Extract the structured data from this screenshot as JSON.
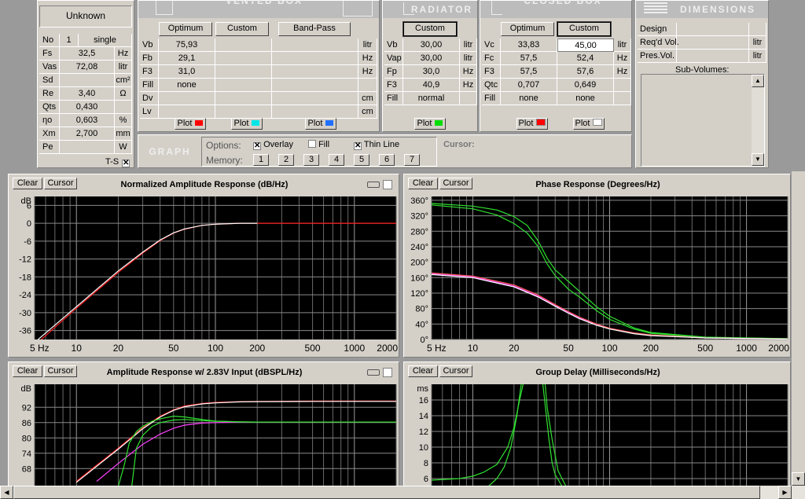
{
  "driver": {
    "name": "Unknown",
    "no_label": "No",
    "no_value": "1",
    "mode": "single",
    "params": [
      {
        "sym": "Fs",
        "val": "32,5",
        "unit": "Hz"
      },
      {
        "sym": "Vas",
        "val": "72,08",
        "unit": "litr"
      },
      {
        "sym": "Sd",
        "val": "",
        "unit": "cm²"
      },
      {
        "sym": "Re",
        "val": "3,40",
        "unit": "Ω"
      },
      {
        "sym": "Qts",
        "val": "0,430",
        "unit": ""
      },
      {
        "sym": "ηo",
        "val": "0,603",
        "unit": "%"
      },
      {
        "sym": "Xm",
        "val": "2,700",
        "unit": "mm"
      },
      {
        "sym": "Pe",
        "val": "",
        "unit": "W"
      }
    ],
    "ts_label": "T-S"
  },
  "vented": {
    "title": "VENTED BOX",
    "buttons": [
      "Optimum",
      "Custom",
      "Band-Pass"
    ],
    "rows": [
      {
        "sym": "Vb",
        "c1": "75,93",
        "c2": "",
        "c3": "",
        "unit": "litr"
      },
      {
        "sym": "Fb",
        "c1": "29,1",
        "c2": "",
        "c3": "",
        "unit": "Hz"
      },
      {
        "sym": "F3",
        "c1": "31,0",
        "c2": "",
        "c3": "",
        "unit": "Hz"
      },
      {
        "sym": "Fill",
        "c1": "none",
        "c2": "",
        "c3": "",
        "unit": ""
      },
      {
        "sym": "Dv",
        "c1": "",
        "c2": "",
        "c3": "",
        "unit": "cm"
      },
      {
        "sym": "Lv",
        "c1": "",
        "c2": "",
        "c3": "",
        "unit": "cm"
      }
    ],
    "plot_label": "Plot",
    "plot_colors": [
      "#ff0000",
      "#00e5e5",
      "#1f6fff"
    ]
  },
  "radiator": {
    "title": "RADIATOR",
    "button": "Custom",
    "rows": [
      {
        "sym": "Vb",
        "val": "30,00",
        "unit": "litr"
      },
      {
        "sym": "Vap",
        "val": "30,00",
        "unit": "litr"
      },
      {
        "sym": "Fp",
        "val": "30,0",
        "unit": "Hz"
      },
      {
        "sym": "F3",
        "val": "40,9",
        "unit": "Hz"
      },
      {
        "sym": "Fill",
        "val": "normal",
        "unit": ""
      }
    ],
    "plot_label": "Plot",
    "plot_color": "#00dd00"
  },
  "closed": {
    "title": "CLOSED BOX",
    "buttons": [
      "Optimum",
      "Custom"
    ],
    "rows": [
      {
        "sym": "Vc",
        "c1": "33,83",
        "c2": "45,00",
        "unit": "litr"
      },
      {
        "sym": "Fc",
        "c1": "57,5",
        "c2": "52,4",
        "unit": "Hz"
      },
      {
        "sym": "F3",
        "c1": "57,5",
        "c2": "57,6",
        "unit": "Hz"
      },
      {
        "sym": "Qtc",
        "c1": "0,707",
        "c2": "0,649",
        "unit": ""
      },
      {
        "sym": "Fill",
        "c1": "none",
        "c2": "none",
        "unit": ""
      }
    ],
    "plot_label": "Plot",
    "plot_colors": [
      "#ff0000",
      "#ffffff"
    ]
  },
  "dimensions": {
    "title": "DIMENSIONS",
    "rows": [
      {
        "label": "Design",
        "unit": ""
      },
      {
        "label": "Req'd Vol.",
        "unit": "litr"
      },
      {
        "label": "Pres.Vol.",
        "unit": "litr"
      }
    ],
    "subvol_label": "Sub-Volumes:"
  },
  "graph": {
    "title": "GRAPH",
    "options_label": "Options:",
    "overlay_label": "Overlay",
    "fill_label": "Fill",
    "thinline_label": "Thin Line",
    "memory_label": "Memory:",
    "memory": [
      "1",
      "2",
      "3",
      "4",
      "5",
      "6",
      "7"
    ],
    "cursor_label": "Cursor:"
  },
  "chart_buttons": {
    "clear": "Clear",
    "cursor": "Cursor"
  },
  "chart_data": [
    {
      "type": "line",
      "title": "Normalized Amplitude Response (dB/Hz)",
      "x_scale": "log",
      "xlim": [
        5,
        2000
      ],
      "ylim": [
        -39,
        9
      ],
      "x_ticks": [
        {
          "v": 5,
          "t": "5 Hz"
        },
        {
          "v": 10,
          "t": "10"
        },
        {
          "v": 20,
          "t": "20"
        },
        {
          "v": 50,
          "t": "50"
        },
        {
          "v": 100,
          "t": "100"
        },
        {
          "v": 200,
          "t": "200"
        },
        {
          "v": 500,
          "t": "500"
        },
        {
          "v": 1000,
          "t": "1000"
        },
        {
          "v": 2000,
          "t": "2000"
        }
      ],
      "y_unit": "dB",
      "y_ticks": [
        6,
        0,
        -6,
        -12,
        -18,
        -24,
        -30,
        -36
      ],
      "series": [
        {
          "color": "#ff2020",
          "x": [
            5,
            10,
            20,
            30,
            40,
            50,
            60,
            80,
            100,
            150,
            200,
            500,
            2000
          ],
          "y": [
            -41,
            -28.5,
            -16.5,
            -10,
            -5.8,
            -3.3,
            -2,
            -0.7,
            -0.3,
            0,
            0,
            0,
            0
          ]
        },
        {
          "color": "#ffffff",
          "x": [
            5,
            10,
            20,
            30,
            40,
            50,
            60,
            80,
            100,
            150,
            200
          ],
          "y": [
            -40,
            -28,
            -16,
            -9.7,
            -5.6,
            -3.2,
            -1.9,
            -0.7,
            -0.3,
            0,
            0
          ]
        }
      ]
    },
    {
      "type": "line",
      "title": "Phase Response (Degrees/Hz)",
      "x_scale": "log",
      "xlim": [
        5,
        2000
      ],
      "ylim": [
        0,
        370
      ],
      "x_ticks": [
        {
          "v": 5,
          "t": "5 Hz"
        },
        {
          "v": 10,
          "t": "10"
        },
        {
          "v": 20,
          "t": "20"
        },
        {
          "v": 50,
          "t": "50"
        },
        {
          "v": 100,
          "t": "100"
        },
        {
          "v": 200,
          "t": "200"
        },
        {
          "v": 500,
          "t": "500"
        },
        {
          "v": 1000,
          "t": "1000"
        },
        {
          "v": 2000,
          "t": "2000"
        }
      ],
      "y_ticks": [
        {
          "v": 360,
          "t": "360°"
        },
        {
          "v": 320,
          "t": "320°"
        },
        {
          "v": 280,
          "t": "280°"
        },
        {
          "v": 240,
          "t": "240°"
        },
        {
          "v": 200,
          "t": "200°"
        },
        {
          "v": 160,
          "t": "160°"
        },
        {
          "v": 120,
          "t": "120°"
        },
        {
          "v": 80,
          "t": "80°"
        },
        {
          "v": 40,
          "t": "40°"
        },
        {
          "v": 0,
          "t": "0°"
        }
      ],
      "series": [
        {
          "color": "#30e030",
          "x": [
            5,
            10,
            15,
            20,
            25,
            30,
            35,
            40,
            50,
            60,
            80,
            100,
            150,
            200,
            500,
            2000
          ],
          "y": [
            352,
            345,
            335,
            318,
            295,
            255,
            210,
            180,
            150,
            125,
            85,
            60,
            30,
            18,
            6,
            2
          ]
        },
        {
          "color": "#30e030",
          "x": [
            5,
            10,
            15,
            20,
            25,
            30,
            35,
            40,
            50,
            60,
            80,
            100,
            150,
            200,
            500,
            2000
          ],
          "y": [
            348,
            338,
            322,
            300,
            275,
            240,
            195,
            165,
            130,
            110,
            75,
            52,
            27,
            16,
            5,
            2
          ]
        },
        {
          "color": "#ff40ff",
          "x": [
            5,
            10,
            20,
            30,
            40,
            50,
            60,
            80,
            100,
            150,
            200,
            500,
            2000
          ],
          "y": [
            170,
            162,
            138,
            112,
            88,
            70,
            56,
            38,
            28,
            16,
            11,
            4,
            1
          ]
        },
        {
          "color": "#ff6060",
          "x": [
            5,
            10,
            20,
            30,
            40,
            50,
            60,
            80,
            100,
            150,
            200,
            500,
            2000
          ],
          "y": [
            172,
            164,
            141,
            115,
            90,
            72,
            58,
            40,
            29,
            17,
            12,
            4,
            1
          ]
        },
        {
          "color": "#ffffff",
          "x": [
            5,
            10,
            20,
            30,
            40,
            50,
            60,
            80,
            100,
            150,
            200,
            500,
            2000
          ],
          "y": [
            168,
            160,
            136,
            110,
            86,
            68,
            54,
            37,
            27,
            15,
            10,
            4,
            1
          ]
        }
      ]
    },
    {
      "type": "line",
      "title": "Amplitude Response w/ 2.83V Input (dBSPL/Hz)",
      "x_scale": "log",
      "xlim": [
        5,
        2000
      ],
      "ylim": [
        61,
        101
      ],
      "y_unit": "dB",
      "y_ticks": [
        92,
        86,
        80,
        74,
        68
      ],
      "series": [
        {
          "color": "#ff2020",
          "x": [
            10,
            20,
            30,
            40,
            50,
            60,
            80,
            100,
            150,
            200,
            500,
            2000
          ],
          "y": [
            63,
            76,
            84,
            88.5,
            91,
            92.5,
            93.5,
            93.9,
            94.2,
            94.3,
            94.4,
            94.4
          ]
        },
        {
          "color": "#ffffff",
          "x": [
            10,
            20,
            30,
            40,
            50,
            60,
            80,
            100,
            150,
            200,
            500,
            2000
          ],
          "y": [
            62.6,
            75.6,
            83.6,
            88.2,
            90.8,
            92.2,
            93.3,
            93.7,
            94.1,
            94.2,
            94.3,
            94.3
          ]
        },
        {
          "color": "#ff40ff",
          "x": [
            14,
            20,
            30,
            40,
            50,
            60,
            80,
            100,
            150,
            200,
            500,
            2000
          ],
          "y": [
            63,
            70,
            77.5,
            81.5,
            83.8,
            85,
            85.8,
            86,
            86.2,
            86.2,
            86.2,
            86.2
          ]
        },
        {
          "color": "#30e030",
          "x": [
            20,
            22,
            24,
            27,
            30,
            35,
            40,
            50,
            60,
            80,
            100,
            150,
            200,
            500,
            2000
          ],
          "y": [
            61,
            69,
            78,
            82.5,
            84.5,
            86.5,
            87.5,
            88.5,
            88.2,
            87.2,
            86.6,
            86.3,
            86.2,
            86.2,
            86.2
          ]
        },
        {
          "color": "#30e030",
          "x": [
            25,
            27,
            30,
            35,
            40,
            50,
            60,
            80,
            100,
            150,
            200
          ],
          "y": [
            61,
            76,
            81,
            84.5,
            86,
            87,
            87.2,
            86.8,
            86.5,
            86.3,
            86.2
          ]
        }
      ]
    },
    {
      "type": "line",
      "title": "Group Delay (Milliseconds/Hz)",
      "x_scale": "log",
      "xlim": [
        5,
        2000
      ],
      "ylim": [
        5,
        18
      ],
      "y_unit": "ms",
      "y_ticks": [
        16,
        14,
        12,
        10,
        8,
        6
      ],
      "series": [
        {
          "color": "#30e030",
          "x": [
            5,
            8,
            10,
            12,
            15,
            18,
            20,
            22,
            24,
            26
          ],
          "y": [
            5.8,
            6.0,
            6.3,
            6.8,
            7.8,
            10,
            12.5,
            16,
            19,
            22
          ]
        },
        {
          "color": "#30e030",
          "x": [
            13,
            15,
            17,
            19,
            21,
            23
          ],
          "y": [
            5,
            6,
            7.5,
            10,
            14,
            19
          ]
        },
        {
          "color": "#30e030",
          "x": [
            30,
            32,
            34,
            36,
            38,
            40,
            45
          ],
          "y": [
            22,
            19,
            15,
            11,
            8,
            6.5,
            5
          ]
        },
        {
          "color": "#30e030",
          "x": [
            33,
            35,
            38,
            42,
            48
          ],
          "y": [
            20,
            15,
            11,
            7,
            5
          ]
        }
      ]
    }
  ]
}
